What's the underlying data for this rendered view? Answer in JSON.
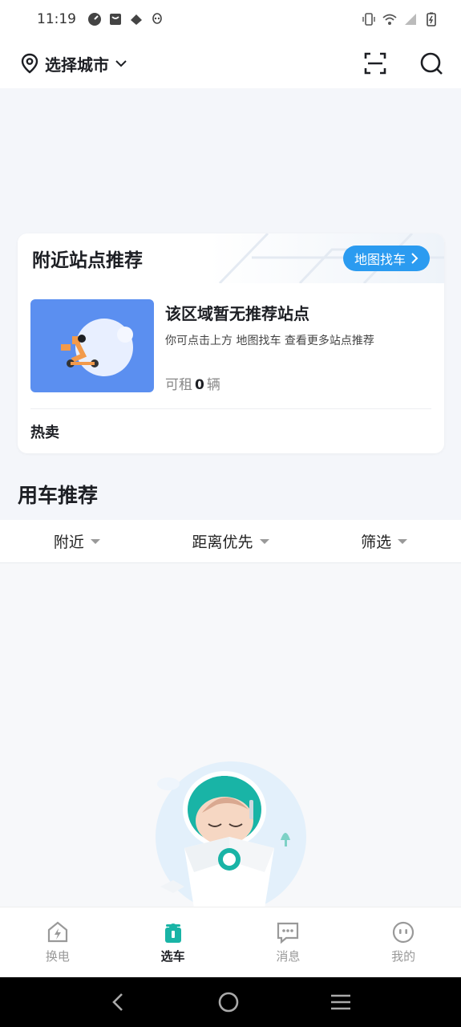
{
  "status_bar": {
    "time": "11:19"
  },
  "header": {
    "city_label": "选择城市"
  },
  "nearby_card": {
    "title": "附近站点推荐",
    "map_button_label": "地图找车",
    "empty_title": "该区域暂无推荐站点",
    "empty_hint": "你可点击上方 地图找车 查看更多站点推荐",
    "available_prefix": "可租",
    "available_count": "0",
    "available_suffix": "辆",
    "hot_label": "热卖"
  },
  "recommend": {
    "section_title": "用车推荐",
    "filters": [
      {
        "label": "附近"
      },
      {
        "label": "距离优先"
      },
      {
        "label": "筛选"
      }
    ]
  },
  "tabbar": {
    "items": [
      {
        "label": "换电",
        "icon": "battery-swap-icon",
        "active": false
      },
      {
        "label": "选车",
        "icon": "select-vehicle-icon",
        "active": true
      },
      {
        "label": "消息",
        "icon": "message-icon",
        "active": false
      },
      {
        "label": "我的",
        "icon": "profile-icon",
        "active": false
      }
    ]
  },
  "colors": {
    "accent": "#2b9bf0",
    "brand_teal": "#19b4a6",
    "background": "#f4f6fa"
  }
}
